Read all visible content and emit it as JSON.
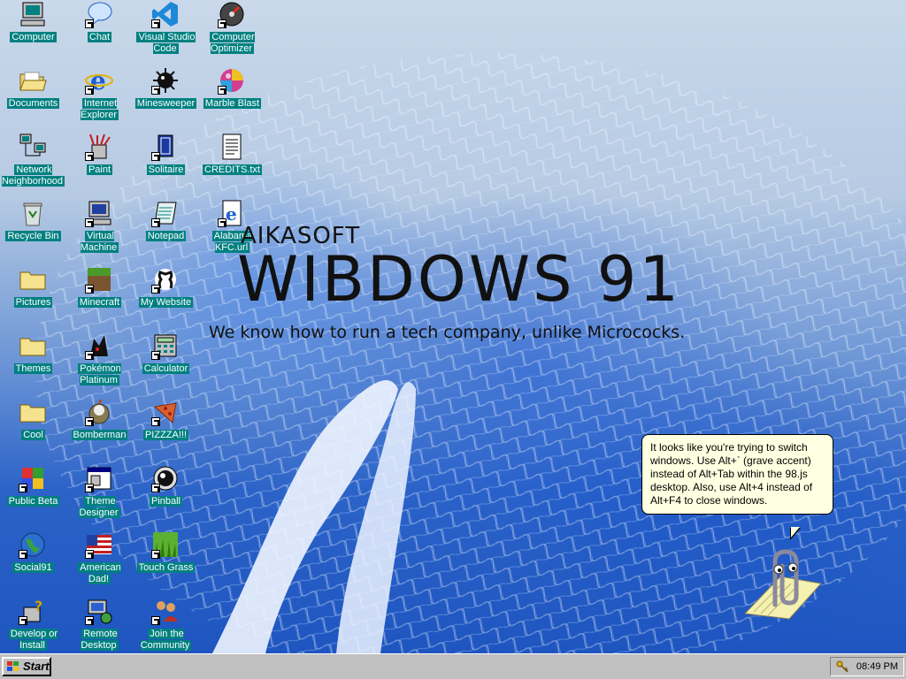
{
  "desktop": {
    "icons": [
      {
        "label": "Computer",
        "icon": "computer-icon",
        "shortcut": false
      },
      {
        "label": "Chat",
        "icon": "chat-icon",
        "shortcut": true
      },
      {
        "label": "Visual Studio Code",
        "icon": "vscode-icon",
        "shortcut": true
      },
      {
        "label": "Computer Optimizer",
        "icon": "optimizer-icon",
        "shortcut": true
      },
      {
        "label": "Documents",
        "icon": "folder-open-icon",
        "shortcut": false
      },
      {
        "label": "Internet Explorer",
        "icon": "internet-explorer-icon",
        "shortcut": true
      },
      {
        "label": "Minesweeper",
        "icon": "minesweeper-icon",
        "shortcut": true
      },
      {
        "label": "Marble Blast",
        "icon": "marble-icon",
        "shortcut": true
      },
      {
        "label": "Network Neighborhood",
        "icon": "network-icon",
        "shortcut": false
      },
      {
        "label": "Paint",
        "icon": "paint-icon",
        "shortcut": true
      },
      {
        "label": "Solitaire",
        "icon": "solitaire-icon",
        "shortcut": true
      },
      {
        "label": "CREDITS.txt",
        "icon": "text-file-icon",
        "shortcut": false
      },
      {
        "label": "Recycle Bin",
        "icon": "recycle-bin-icon",
        "shortcut": false
      },
      {
        "label": "Virtual Machine",
        "icon": "virtual-machine-icon",
        "shortcut": true
      },
      {
        "label": "Notepad",
        "icon": "notepad-icon",
        "shortcut": true
      },
      {
        "label": "Alabama KFC.url",
        "icon": "ie-document-icon",
        "shortcut": true
      },
      {
        "label": "Pictures",
        "icon": "folder-icon",
        "shortcut": false
      },
      {
        "label": "Minecraft",
        "icon": "minecraft-icon",
        "shortcut": true
      },
      {
        "label": "My Website",
        "icon": "github-icon",
        "shortcut": true
      },
      {
        "label": "Themes",
        "icon": "folder-icon",
        "shortcut": false
      },
      {
        "label": "Pokémon Platinum",
        "icon": "pokemon-icon",
        "shortcut": true
      },
      {
        "label": "Calculator",
        "icon": "calculator-icon",
        "shortcut": true
      },
      {
        "label": "Cool",
        "icon": "folder-icon",
        "shortcut": false
      },
      {
        "label": "Bomberman",
        "icon": "bomberman-icon",
        "shortcut": true
      },
      {
        "label": "PIZZZA!!!",
        "icon": "pizza-icon",
        "shortcut": true
      },
      {
        "label": "Public Beta",
        "icon": "public-beta-icon",
        "shortcut": true
      },
      {
        "label": "Theme Designer",
        "icon": "theme-designer-icon",
        "shortcut": true
      },
      {
        "label": "Pinball",
        "icon": "pinball-icon",
        "shortcut": true
      },
      {
        "label": "Social91",
        "icon": "globe-icon",
        "shortcut": true
      },
      {
        "label": "American Dad!",
        "icon": "flag-icon",
        "shortcut": true
      },
      {
        "label": "Touch Grass",
        "icon": "grass-icon",
        "shortcut": true
      },
      {
        "label": "Develop or Install",
        "icon": "help-install-icon",
        "shortcut": true
      },
      {
        "label": "Remote Desktop",
        "icon": "remote-desktop-icon",
        "shortcut": true
      },
      {
        "label": "Join the Community",
        "icon": "community-icon",
        "shortcut": true
      }
    ]
  },
  "wallpaper": {
    "brand_small": "AIKASOFT",
    "brand_big": "WIBDOWS 91",
    "tagline": "We know how to run a tech company, unlike Micrococks."
  },
  "assistant": {
    "tip": "It looks like you're trying to switch windows. Use Alt+` (grave accent) instead of Alt+Tab within the 98.js desktop. Also, use Alt+4 instead of Alt+F4 to close windows.",
    "icon": "paperclip-assistant-icon"
  },
  "taskbar": {
    "start_label": "Start",
    "clock": "08:49 PM",
    "tray_icon": "key-icon"
  },
  "colors": {
    "label_bg": "#008080",
    "taskbar": "#c0c0c0",
    "tooltip_bg": "#ffffe1"
  }
}
